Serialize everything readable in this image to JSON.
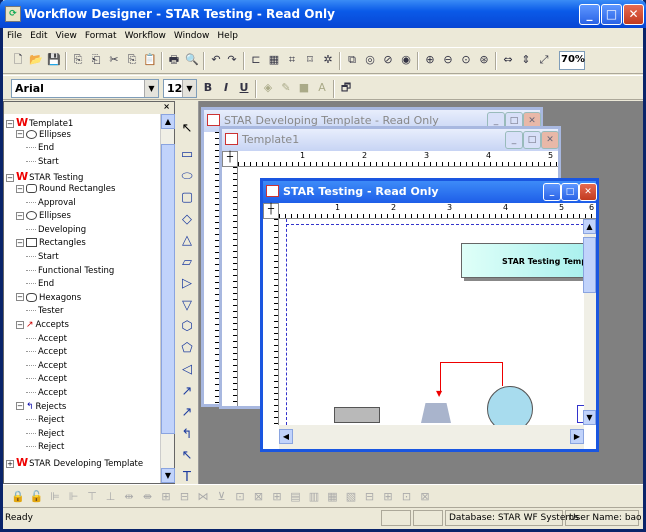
{
  "window": {
    "title": "Workflow Designer - STAR Testing - Read Only"
  },
  "menu": [
    "File",
    "Edit",
    "View",
    "Format",
    "Workflow",
    "Window",
    "Help"
  ],
  "format_bar": {
    "font": "Arial",
    "size": "12",
    "bold": "B",
    "italic": "I",
    "underline": "U",
    "text_a": "A"
  },
  "zoom": "70%",
  "tree": {
    "close": "×",
    "rows": [
      {
        "label": "Template1",
        "kind": "template",
        "indent": 0,
        "exp": "−"
      },
      {
        "label": "Ellipses",
        "kind": "ellipse",
        "indent": 1,
        "exp": "−"
      },
      {
        "label": "End",
        "kind": "leaf",
        "indent": 2
      },
      {
        "label": "Start",
        "kind": "leaf",
        "indent": 2
      },
      {
        "label": "STAR Testing",
        "kind": "template",
        "indent": 0,
        "exp": "−"
      },
      {
        "label": "Round Rectangles",
        "kind": "rrect",
        "indent": 1,
        "exp": "−"
      },
      {
        "label": "Approval",
        "kind": "leaf",
        "indent": 2
      },
      {
        "label": "Ellipses",
        "kind": "ellipse",
        "indent": 1,
        "exp": "−"
      },
      {
        "label": "Developing",
        "kind": "leaf",
        "indent": 2
      },
      {
        "label": "Rectangles",
        "kind": "rect",
        "indent": 1,
        "exp": "−"
      },
      {
        "label": "Start",
        "kind": "leaf",
        "indent": 2
      },
      {
        "label": "Functional Testing",
        "kind": "leaf",
        "indent": 2
      },
      {
        "label": "End",
        "kind": "leaf",
        "indent": 2
      },
      {
        "label": "Hexagons",
        "kind": "hex",
        "indent": 1,
        "exp": "−"
      },
      {
        "label": "Tester",
        "kind": "leaf",
        "indent": 2
      },
      {
        "label": "Accepts",
        "kind": "accept",
        "indent": 1,
        "exp": "−"
      },
      {
        "label": "Accept",
        "kind": "leaf",
        "indent": 2
      },
      {
        "label": "Accept",
        "kind": "leaf",
        "indent": 2
      },
      {
        "label": "Accept",
        "kind": "leaf",
        "indent": 2
      },
      {
        "label": "Accept",
        "kind": "leaf",
        "indent": 2
      },
      {
        "label": "Accept",
        "kind": "leaf",
        "indent": 2
      },
      {
        "label": "Rejects",
        "kind": "reject",
        "indent": 1,
        "exp": "−"
      },
      {
        "label": "Reject",
        "kind": "leaf",
        "indent": 2
      },
      {
        "label": "Reject",
        "kind": "leaf",
        "indent": 2
      },
      {
        "label": "Reject",
        "kind": "leaf",
        "indent": 2
      },
      {
        "label": "STAR Developing Template",
        "kind": "template",
        "indent": 0,
        "exp": "+"
      }
    ]
  },
  "palette": [
    "▭",
    "⬭",
    "▢",
    "◇",
    "△",
    "▱",
    "▷",
    "▽",
    "⬡",
    "⬠",
    "◁",
    "↗",
    "↗",
    "↰",
    "↖",
    "T"
  ],
  "windows": {
    "dev": {
      "title": "STAR Developing Template - Read Only"
    },
    "tpl": {
      "title": "Template1"
    },
    "star": {
      "title": "STAR Testing - Read Only",
      "node_label": "STAR Testing Templa"
    }
  },
  "ruler_numbers": [
    "1",
    "2",
    "3",
    "4",
    "5",
    "6"
  ],
  "status": {
    "ready": "Ready",
    "database": "Database: STAR WF Systems",
    "user": "User Name: bao"
  }
}
